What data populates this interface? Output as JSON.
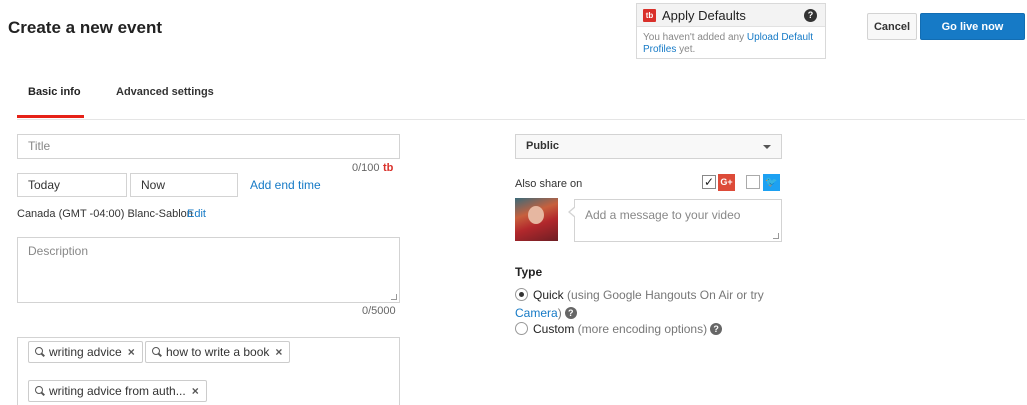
{
  "page": {
    "title": "Create a new event"
  },
  "defaults": {
    "logo": "tb",
    "title": "Apply Defaults",
    "help": "?",
    "body_prefix": "You haven't added any ",
    "body_link": "Upload Default Profiles",
    "body_suffix": " yet."
  },
  "actions": {
    "cancel": "Cancel",
    "go_live": "Go live now"
  },
  "tabs": [
    {
      "label": "Basic info",
      "active": true
    },
    {
      "label": "Advanced settings",
      "active": false
    }
  ],
  "basic": {
    "title_placeholder": "Title",
    "title_count": "0/100",
    "title_badge": "tb",
    "date_value": "Today",
    "time_value": "Now",
    "end_time_link": "Add end time",
    "timezone": "Canada (GMT -04:00) Blanc-Sablon",
    "timezone_edit": "Edit",
    "description_placeholder": "Description",
    "description_count": "0/5000",
    "tags": [
      {
        "label": "writing advice",
        "remove": "×"
      },
      {
        "label": "how to write a book",
        "remove": "×"
      },
      {
        "label": "writing advice from auth...",
        "remove": "×"
      }
    ]
  },
  "right": {
    "privacy": "Public",
    "share_label": "Also share on",
    "share": {
      "google_plus": {
        "checked": true,
        "glyph": "✓",
        "logo": "G+"
      },
      "twitter": {
        "checked": false,
        "logo": "🐦"
      }
    },
    "message_placeholder": "Add a message to your video",
    "type_label": "Type",
    "options": {
      "quick": {
        "name": "Quick",
        "desc_line1": " (using Google Hangouts On Air or try",
        "link": "Camera",
        "desc_after": ")",
        "selected": true
      },
      "custom": {
        "name": "Custom",
        "desc": " (more encoding options)",
        "selected": false
      }
    },
    "help": "?"
  },
  "colors": {
    "accent": "#e62117",
    "primary_button": "#167ac6",
    "link": "#167ac6",
    "google_plus": "#dd4b39",
    "twitter": "#1da1f2",
    "tubebuddy": "#d9302a"
  }
}
